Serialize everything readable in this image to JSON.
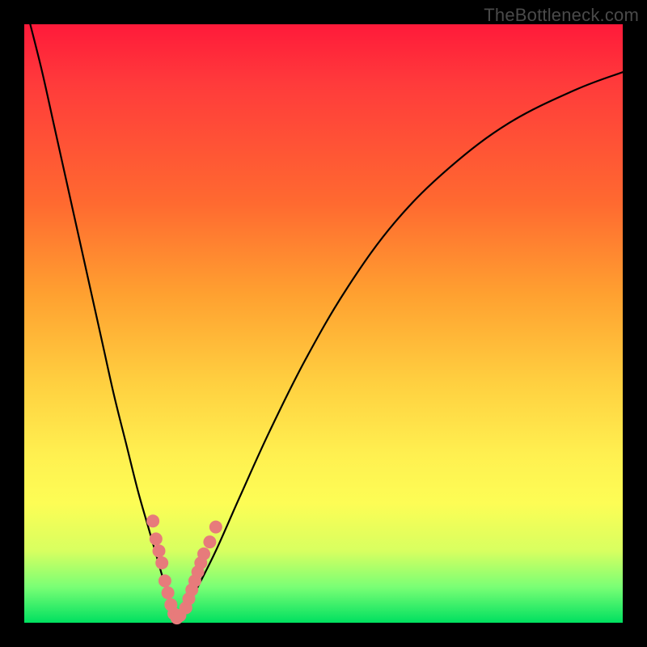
{
  "watermark": {
    "text": "TheBottleneck.com"
  },
  "colors": {
    "curve": "#000000",
    "marker_fill": "#e77b7b",
    "marker_stroke": "#c05858"
  },
  "chart_data": {
    "type": "line",
    "title": "",
    "xlabel": "",
    "ylabel": "",
    "xlim": [
      0,
      100
    ],
    "ylim": [
      0,
      100
    ],
    "grid": false,
    "legend": false,
    "series": [
      {
        "name": "bottleneck-curve",
        "x": [
          1,
          3,
          5,
          7,
          9,
          11,
          13,
          15,
          17,
          19,
          21,
          23,
          24.5,
          25.5,
          27,
          29,
          32,
          36,
          41,
          47,
          54,
          62,
          71,
          81,
          92,
          100
        ],
        "values": [
          100,
          92,
          83,
          74,
          65,
          56,
          47,
          38,
          30,
          22,
          15,
          8,
          3,
          0.5,
          2,
          6,
          12,
          21,
          32,
          44,
          56,
          67,
          76,
          83.5,
          89,
          92
        ]
      }
    ],
    "markers": {
      "name": "highlight-points",
      "x": [
        21.5,
        22,
        22.5,
        23,
        23.5,
        24,
        24.5,
        25,
        25.5,
        26,
        27,
        27.5,
        28,
        28.5,
        29,
        29.5,
        30,
        31,
        32
      ],
      "values": [
        17,
        14,
        12,
        10,
        7,
        5,
        3,
        1.5,
        0.8,
        1.2,
        2.5,
        4,
        5.5,
        7,
        8.5,
        10,
        11.5,
        13.5,
        16
      ]
    }
  }
}
